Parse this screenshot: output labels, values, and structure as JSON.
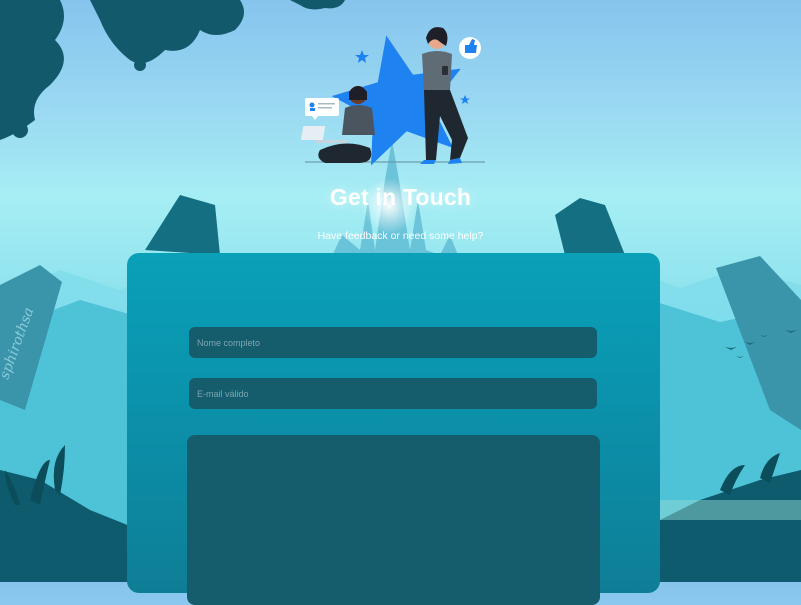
{
  "header": {
    "title": "Get in Touch",
    "subtitle": "Have feedback or need some help?"
  },
  "form": {
    "name_placeholder": "Nome completo",
    "email_placeholder": "E-mail válido",
    "message_placeholder": ""
  },
  "background": {
    "signature": "sphirothsa"
  },
  "colors": {
    "card": "#0b93ad",
    "field": "#155c6c",
    "star": "#1e82f0"
  },
  "icons": [
    "like-icon",
    "user-card-icon",
    "star-icon",
    "laptop-icon"
  ]
}
